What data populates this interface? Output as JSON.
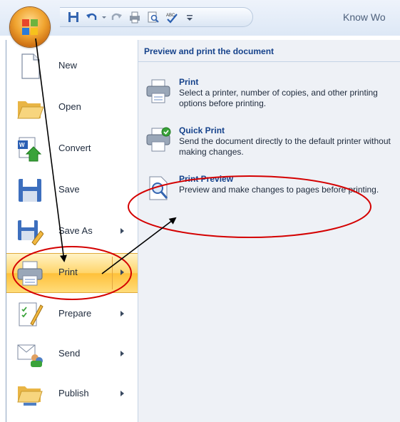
{
  "window": {
    "title": "Know Wo"
  },
  "colors": {
    "accent": "#15428b",
    "annotation_red": "#d40000",
    "active_highlight": "#ffc13a"
  },
  "quick_access": [
    {
      "icon": "save-icon"
    },
    {
      "icon": "undo-icon"
    },
    {
      "icon": "redo-icon"
    },
    {
      "icon": "quick-print-icon"
    },
    {
      "icon": "print-preview-icon"
    },
    {
      "icon": "spelling-icon"
    },
    {
      "icon": "customize-dropdown-icon"
    }
  ],
  "menu": {
    "items": [
      {
        "label": "New",
        "icon": "new-document-icon",
        "has_submenu": false
      },
      {
        "label": "Open",
        "icon": "open-folder-icon",
        "has_submenu": false
      },
      {
        "label": "Convert",
        "icon": "convert-icon",
        "has_submenu": false
      },
      {
        "label": "Save",
        "icon": "save-icon",
        "has_submenu": false
      },
      {
        "label": "Save As",
        "icon": "save-as-icon",
        "has_submenu": true
      },
      {
        "label": "Print",
        "icon": "printer-icon",
        "has_submenu": true,
        "active": true
      },
      {
        "label": "Prepare",
        "icon": "prepare-icon",
        "has_submenu": true
      },
      {
        "label": "Send",
        "icon": "send-icon",
        "has_submenu": true
      },
      {
        "label": "Publish",
        "icon": "publish-icon",
        "has_submenu": true
      }
    ]
  },
  "submenu": {
    "header": "Preview and print the document",
    "options": [
      {
        "title": "Print",
        "description": "Select a printer, number of copies, and other printing options before printing.",
        "icon": "printer-icon"
      },
      {
        "title": "Quick Print",
        "description": "Send the document directly to the default printer without making changes.",
        "icon": "quick-print-icon"
      },
      {
        "title": "Print Preview",
        "description": "Preview and make changes to pages before printing.",
        "icon": "magnifier-page-icon"
      }
    ]
  }
}
